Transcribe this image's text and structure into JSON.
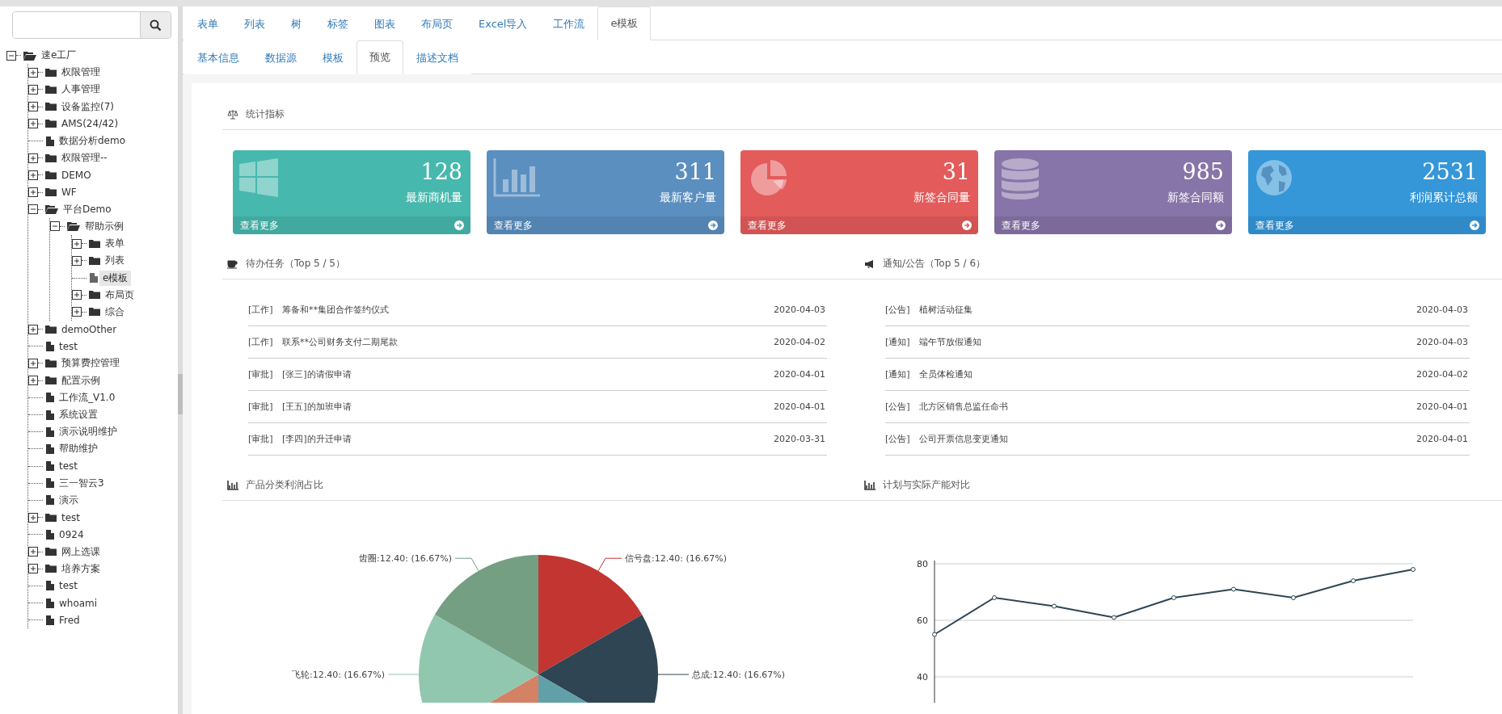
{
  "sidebar": {
    "tree": [
      {
        "label": "速e工厂",
        "kind": "folder",
        "expanded": true,
        "selected": false,
        "children": [
          {
            "label": "权限管理",
            "kind": "folder",
            "expanded": false,
            "selected": false
          },
          {
            "label": "人事管理",
            "kind": "folder",
            "expanded": false,
            "selected": false
          },
          {
            "label": "设备监控(7)",
            "kind": "folder",
            "expanded": false,
            "selected": false
          },
          {
            "label": "AMS(24/42)",
            "kind": "folder",
            "expanded": false,
            "selected": false
          },
          {
            "label": "数据分析demo",
            "kind": "file",
            "selected": false
          },
          {
            "label": "权限管理--",
            "kind": "folder",
            "expanded": false,
            "selected": false
          },
          {
            "label": "DEMO",
            "kind": "folder",
            "expanded": false,
            "selected": false
          },
          {
            "label": "WF",
            "kind": "folder",
            "expanded": false,
            "selected": false
          },
          {
            "label": "平台Demo",
            "kind": "folder",
            "expanded": true,
            "selected": false,
            "children": [
              {
                "label": "帮助示例",
                "kind": "folder",
                "expanded": true,
                "selected": false,
                "children": [
                  {
                    "label": "表单",
                    "kind": "folder",
                    "expanded": false,
                    "selected": false
                  },
                  {
                    "label": "列表",
                    "kind": "folder",
                    "expanded": false,
                    "selected": false
                  },
                  {
                    "label": "e模板",
                    "kind": "file",
                    "selected": true
                  },
                  {
                    "label": "布局页",
                    "kind": "folder",
                    "expanded": false,
                    "selected": false
                  },
                  {
                    "label": "综合",
                    "kind": "folder",
                    "expanded": false,
                    "selected": false
                  }
                ]
              }
            ]
          },
          {
            "label": "demoOther",
            "kind": "folder",
            "expanded": false,
            "selected": false
          },
          {
            "label": "test",
            "kind": "file",
            "selected": false
          },
          {
            "label": "预算费控管理",
            "kind": "folder",
            "expanded": false,
            "selected": false
          },
          {
            "label": "配置示例",
            "kind": "folder",
            "expanded": false,
            "selected": false
          },
          {
            "label": "工作流_V1.0",
            "kind": "file",
            "selected": false
          },
          {
            "label": "系统设置",
            "kind": "file",
            "selected": false
          },
          {
            "label": "演示说明维护",
            "kind": "file",
            "selected": false
          },
          {
            "label": "帮助维护",
            "kind": "file",
            "selected": false
          },
          {
            "label": "test",
            "kind": "file",
            "selected": false
          },
          {
            "label": "三一智云3",
            "kind": "file",
            "selected": false
          },
          {
            "label": "演示",
            "kind": "file",
            "selected": false
          },
          {
            "label": "test",
            "kind": "folder",
            "expanded": false,
            "selected": false
          },
          {
            "label": "0924",
            "kind": "file",
            "selected": false
          },
          {
            "label": "网上选课",
            "kind": "folder",
            "expanded": false,
            "selected": false
          },
          {
            "label": "培养方案",
            "kind": "folder",
            "expanded": false,
            "selected": false
          },
          {
            "label": "test",
            "kind": "file",
            "selected": false
          },
          {
            "label": "whoami",
            "kind": "file",
            "selected": false
          },
          {
            "label": "Fred",
            "kind": "file",
            "selected": false
          }
        ]
      }
    ]
  },
  "tabs": [
    {
      "label": "表单",
      "selected": false
    },
    {
      "label": "列表",
      "selected": false
    },
    {
      "label": "树",
      "selected": false
    },
    {
      "label": "标签",
      "selected": false
    },
    {
      "label": "图表",
      "selected": false
    },
    {
      "label": "布局页",
      "selected": false
    },
    {
      "label": "Excel导入",
      "selected": false
    },
    {
      "label": "工作流",
      "selected": false
    },
    {
      "label": "e模板",
      "selected": true
    }
  ],
  "subtabs": [
    {
      "label": "基本信息",
      "selected": false
    },
    {
      "label": "数据源",
      "selected": false
    },
    {
      "label": "模板",
      "selected": false
    },
    {
      "label": "预览",
      "selected": true
    },
    {
      "label": "描述文档",
      "selected": false
    }
  ],
  "stats": {
    "title": "统计指标",
    "cards": [
      {
        "value": "128",
        "label": "最新商机量",
        "more": "查看更多",
        "kind": "windows",
        "color": "#47b8ad"
      },
      {
        "value": "311",
        "label": "最新客户量",
        "more": "查看更多",
        "kind": "bars",
        "color": "#5a8fc0"
      },
      {
        "value": "31",
        "label": "新签合同量",
        "more": "查看更多",
        "kind": "pie",
        "color": "#e35b5b"
      },
      {
        "value": "985",
        "label": "新签合同额",
        "more": "查看更多",
        "kind": "database",
        "color": "#8774a8"
      },
      {
        "value": "2531",
        "label": "利润累计总额",
        "more": "查看更多",
        "kind": "globe",
        "color": "#3596d8"
      }
    ]
  },
  "tasks": {
    "title": "待办任务（Top 5 / 5）",
    "rows": [
      {
        "tag": "[工作]",
        "text": "筹备和**集团合作签约仪式",
        "date": "2020-04-03"
      },
      {
        "tag": "[工作]",
        "text": "联系**公司财务支付二期尾款",
        "date": "2020-04-02"
      },
      {
        "tag": "[审批]",
        "text": "[张三]的请假申请",
        "date": "2020-04-01"
      },
      {
        "tag": "[审批]",
        "text": "[王五]的加班申请",
        "date": "2020-04-01"
      },
      {
        "tag": "[审批]",
        "text": "[李四]的升迁申请",
        "date": "2020-03-31"
      }
    ]
  },
  "notices": {
    "title": "通知/公告（Top 5 / 6）",
    "rows": [
      {
        "tag": "[公告]",
        "text": "植树活动征集",
        "date": "2020-04-03"
      },
      {
        "tag": "[通知]",
        "text": "端午节放假通知",
        "date": "2020-04-03"
      },
      {
        "tag": "[通知]",
        "text": "全员体检通知",
        "date": "2020-04-02"
      },
      {
        "tag": "[公告]",
        "text": "北方区销售总监任命书",
        "date": "2020-04-01"
      },
      {
        "tag": "[公告]",
        "text": "公司开票信息变更通知",
        "date": "2020-04-01"
      }
    ]
  },
  "pie_panel": {
    "title": "产品分类利润占比",
    "chart_data": {
      "type": "pie",
      "series": [
        {
          "values": [
            16.67,
            16.67,
            16.66,
            16.67,
            16.67,
            16.66
          ],
          "colors": [
            "#c23531",
            "#2f4554",
            "#61a0a8",
            "#d48265",
            "#91c7ae",
            "#749f83"
          ]
        }
      ],
      "value_labels": [
        "信号盘:12.40: (16.67%)",
        "总成:12.40: (16.67%)",
        null,
        null,
        "飞轮:12.40: (16.67%)",
        "齿圈:12.40: (16.67%)"
      ]
    }
  },
  "line_panel": {
    "title": "计划与实际产能对比",
    "chart_data": {
      "type": "line",
      "yticks": [
        40,
        60,
        80
      ],
      "ylim": [
        20,
        80
      ],
      "series": [
        {
          "color": "#2f4554",
          "marker": "circle",
          "values": [
            55,
            68,
            65,
            61,
            68,
            71,
            68,
            74,
            78
          ]
        }
      ]
    }
  }
}
